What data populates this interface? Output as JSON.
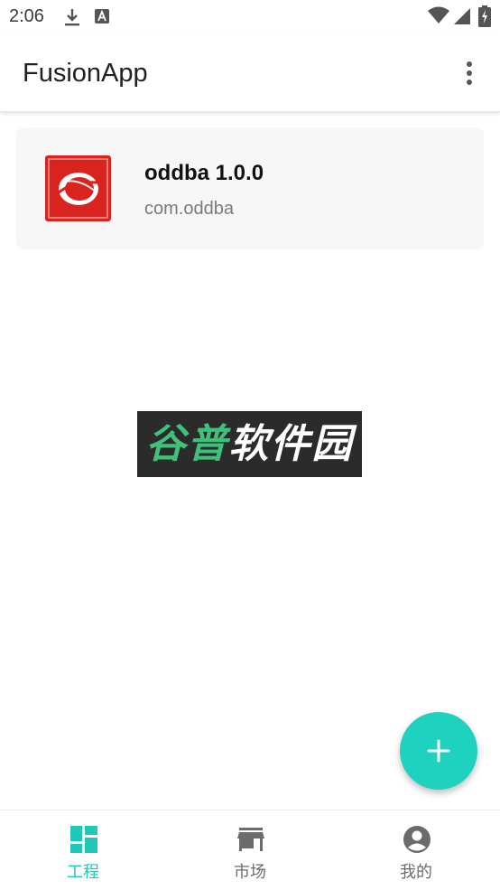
{
  "status_bar": {
    "time": "2:06",
    "icons": [
      "download-icon",
      "notification-a-icon",
      "wifi-icon",
      "signal-icon",
      "battery-charging-icon"
    ]
  },
  "app_bar": {
    "title": "FusionApp",
    "menu_icon": "more-vert-icon"
  },
  "projects": [
    {
      "name": "oddba 1.0.0",
      "package": "com.oddba",
      "icon": "app-logo-red-circle"
    }
  ],
  "watermark": {
    "part1": "谷普",
    "part2": "软件园"
  },
  "fab": {
    "icon": "plus-icon"
  },
  "bottom_nav": {
    "items": [
      {
        "label": "工程",
        "icon": "dashboard-icon",
        "active": true
      },
      {
        "label": "市场",
        "icon": "store-icon",
        "active": false
      },
      {
        "label": "我的",
        "icon": "account-circle-icon",
        "active": false
      }
    ]
  },
  "colors": {
    "accent": "#1fd1bf",
    "active_nav": "#1fc8b8",
    "inactive_nav": "#6b6b6b",
    "card_bg": "#f7f7f7",
    "logo_red": "#d9231f"
  }
}
